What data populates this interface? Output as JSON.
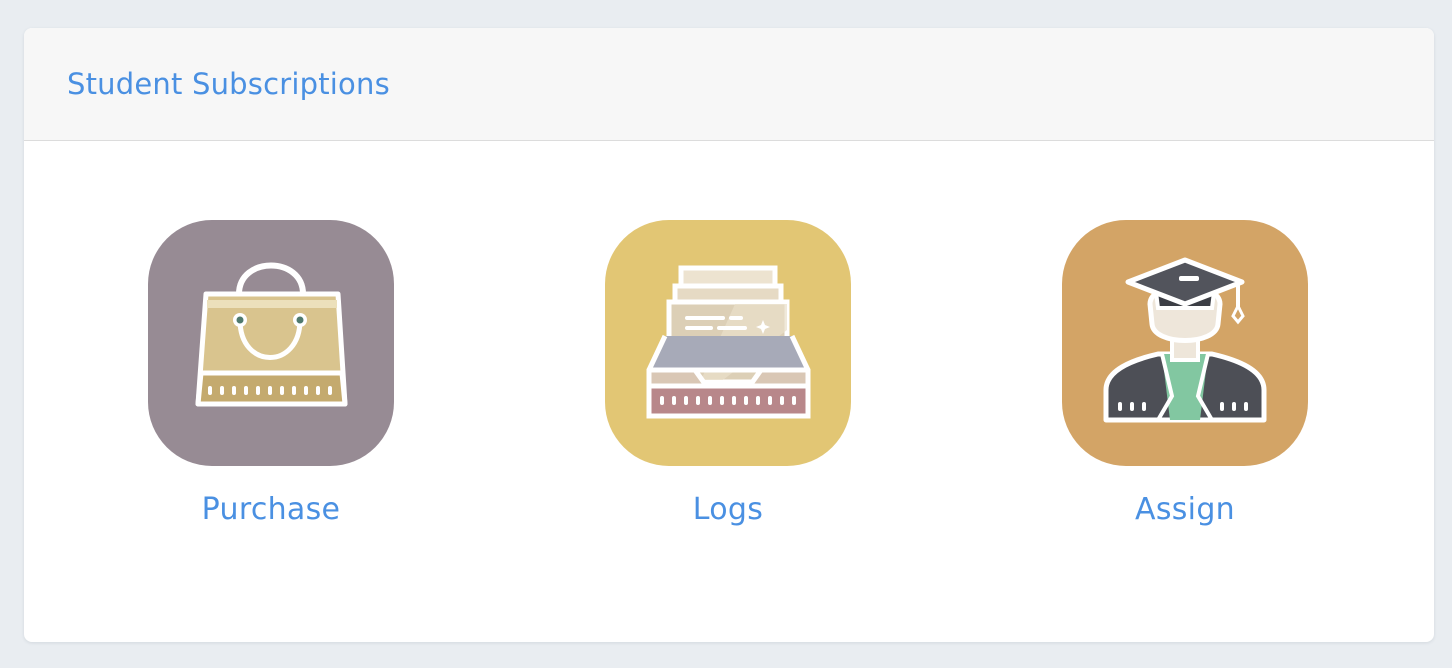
{
  "card": {
    "title": "Student Subscriptions"
  },
  "tiles": [
    {
      "label": "Purchase",
      "icon": "shopping-bag-icon",
      "bg": "#978b94"
    },
    {
      "label": "Logs",
      "icon": "inbox-tray-icon",
      "bg": "#e2c674"
    },
    {
      "label": "Assign",
      "icon": "graduate-student-icon",
      "bg": "#d3a466"
    }
  ],
  "colors": {
    "accent": "#4a90e2",
    "page_bg": "#e9edf1",
    "header_bg": "#f7f7f7"
  }
}
